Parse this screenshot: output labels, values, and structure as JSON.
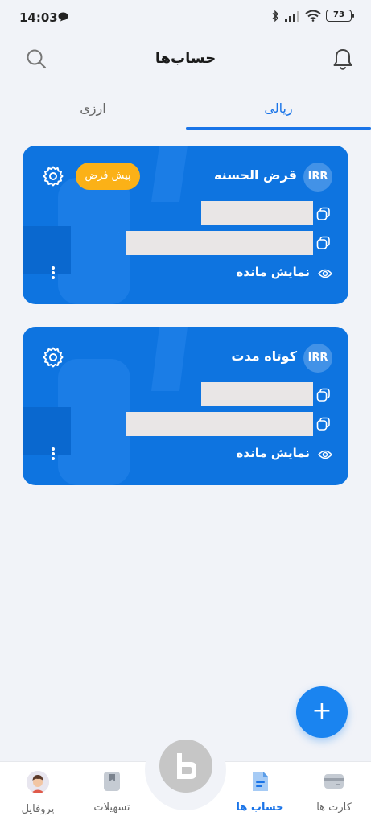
{
  "status_bar": {
    "time": "14:03",
    "battery": "73"
  },
  "header": {
    "title": "حساب‌ها"
  },
  "tabs": [
    {
      "label": "ریالی",
      "active": true
    },
    {
      "label": "ارزی",
      "active": false
    }
  ],
  "accounts": [
    {
      "currency": "IRR",
      "name": "قرض الحسنه",
      "default_label": "پیش فرض",
      "show_balance_label": "نمایش مانده"
    },
    {
      "currency": "IRR",
      "name": "کوتاه مدت",
      "show_balance_label": "نمایش مانده"
    }
  ],
  "fab": {
    "label": "+"
  },
  "bottom_nav": {
    "items": [
      {
        "label": "کارت ها",
        "icon": "card-icon"
      },
      {
        "label": "حساب ها",
        "icon": "document-icon",
        "active": true
      },
      {
        "label": "تسهیلات",
        "icon": "bookmark-icon"
      },
      {
        "label": "پروفایل",
        "icon": "avatar"
      }
    ]
  },
  "colors": {
    "primary": "#1a74e8",
    "card": "#0e74e0",
    "badge": "#fbb117"
  }
}
